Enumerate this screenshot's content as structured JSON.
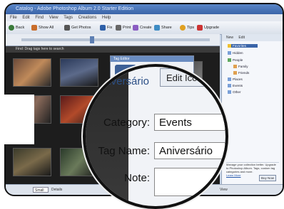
{
  "window": {
    "title": "Catalog - Adobe Photoshop Album 2.0 Starter Edition"
  },
  "menu": [
    "File",
    "Edit",
    "Find",
    "View",
    "Tags",
    "Creations",
    "Help"
  ],
  "toolbar": {
    "items": [
      {
        "label": "Back",
        "icon": "back-icon"
      },
      {
        "label": "Show All",
        "icon": "home-icon"
      },
      {
        "label": "Get Photos",
        "icon": "camera-icon"
      },
      {
        "label": "Fix",
        "icon": "fix-icon"
      },
      {
        "label": "Print",
        "icon": "print-icon"
      },
      {
        "label": "Create",
        "icon": "create-icon"
      },
      {
        "label": "Share",
        "icon": "share-icon"
      },
      {
        "label": "Tips",
        "icon": "tips-icon"
      },
      {
        "label": "Upgrade",
        "icon": "upgrade-icon"
      }
    ]
  },
  "gridheader": "Find: Drag tags here to search",
  "tagdialog": {
    "title": "Tag Editor"
  },
  "lens": {
    "tagname_display": "Aniversário",
    "edit_icon_button": "Edit Icon",
    "category_label": "Category:",
    "category_value": "Events",
    "tagname_label": "Tag Name:",
    "tagname_value": "Aniversário",
    "note_label": "Note:",
    "note_value": ""
  },
  "rightpanel": {
    "tabs": [
      "New",
      "Edit"
    ],
    "tree": [
      "Favorites",
      "Hidden",
      "People",
      "Family",
      "Friends",
      "Places",
      "Events",
      "Other"
    ],
    "promo": "Manage your collection better. Upgrade to Photoshop Album. Tags, custom tag categories and more.",
    "learn_more": "Learn More",
    "buy_button": "Buy Now"
  },
  "statusbar": {
    "zoom_value": "Small",
    "details_label": "Details",
    "view_label": "View"
  },
  "colors": {
    "accent": "#3a64a8",
    "grid_bg": "#1d1d1d",
    "panel_bg": "#f5f7fb"
  }
}
